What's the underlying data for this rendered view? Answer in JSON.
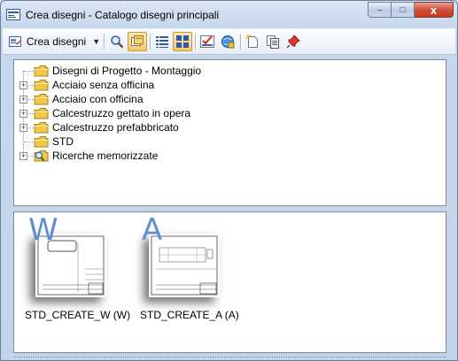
{
  "window": {
    "title": "Crea disegni - Catalogo disegni principali",
    "controls": {
      "minimize": "–",
      "maximize": "□",
      "close": "x"
    }
  },
  "toolbar": {
    "create_label": "Crea disegni",
    "create_arrow": "▼",
    "buttons": [
      "search-icon",
      "preview-icon",
      "list-view-icon",
      "grid-view-icon",
      "spellcheck-icon",
      "search-globe-icon",
      "new-drawing-icon",
      "copy-drawing-icon",
      "pin-icon"
    ]
  },
  "tree": {
    "items": [
      {
        "label": "Disegni di Progetto - Montaggio",
        "icon": "folder-icon",
        "expander": ""
      },
      {
        "label": "Acciaio senza officina",
        "icon": "folder-icon",
        "expander": "+"
      },
      {
        "label": "Acciaio con officina",
        "icon": "folder-icon",
        "expander": "+"
      },
      {
        "label": "Calcestruzzo gettato in opera",
        "icon": "folder-icon",
        "expander": "+"
      },
      {
        "label": "Calcestruzzo prefabbricato",
        "icon": "folder-icon",
        "expander": "+"
      },
      {
        "label": "STD",
        "icon": "folder-icon",
        "expander": ""
      },
      {
        "label": "Ricerche memorizzate",
        "icon": "saved-search-icon",
        "expander": "+"
      }
    ]
  },
  "thumbnails": [
    {
      "letter": "W",
      "label": "STD_CREATE_W (W)"
    },
    {
      "letter": "A",
      "label": "STD_CREATE_A (A)"
    }
  ],
  "colors": {
    "accent": "#5f8fd1",
    "folder": "#f5c84a",
    "close_button": "#cf5039"
  }
}
